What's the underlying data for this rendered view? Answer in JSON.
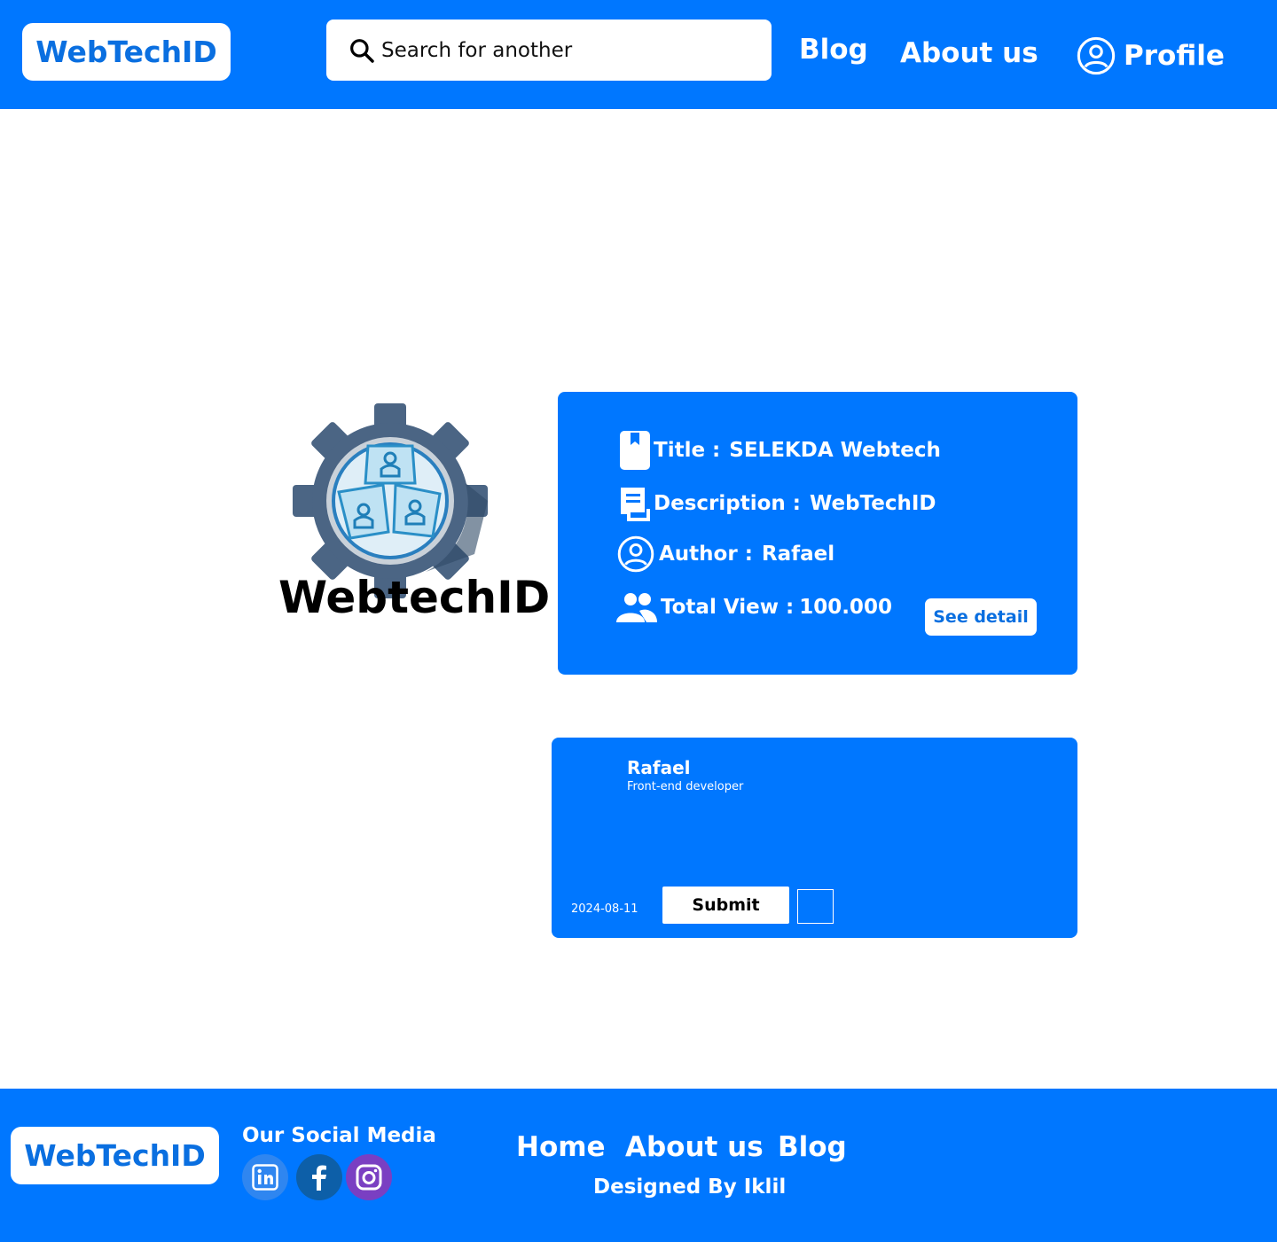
{
  "header": {
    "logo": "WebTechID",
    "search_placeholder": "Search for another",
    "nav": {
      "blog": "Blog",
      "about": "About us",
      "profile": "Profile"
    }
  },
  "hero": {
    "logo_text": "WebtechID"
  },
  "info_card": {
    "title_label": "Title :",
    "title_value": "SELEKDA Webtech",
    "description_label": "Description :",
    "description_value": "WebTechID",
    "author_label": "Author :",
    "author_value": "Rafael",
    "views_label": "Total View :",
    "views_value": "100.000",
    "detail_button": "See detail"
  },
  "comment": {
    "name": "Rafael",
    "role": "Front-end developer",
    "date": "2024-08-11",
    "submit": "Submit"
  },
  "footer": {
    "logo": "WebTechID",
    "social_title": "Our Social Media",
    "social": [
      "linkedin-icon",
      "facebook-icon",
      "instagram-icon"
    ],
    "links": {
      "home": "Home",
      "about": "About us",
      "blog": "Blog"
    },
    "credit": "Designed By Iklil"
  },
  "colors": {
    "primary": "#0077ff",
    "logo_text": "#0a6fe0",
    "white": "#ffffff"
  }
}
